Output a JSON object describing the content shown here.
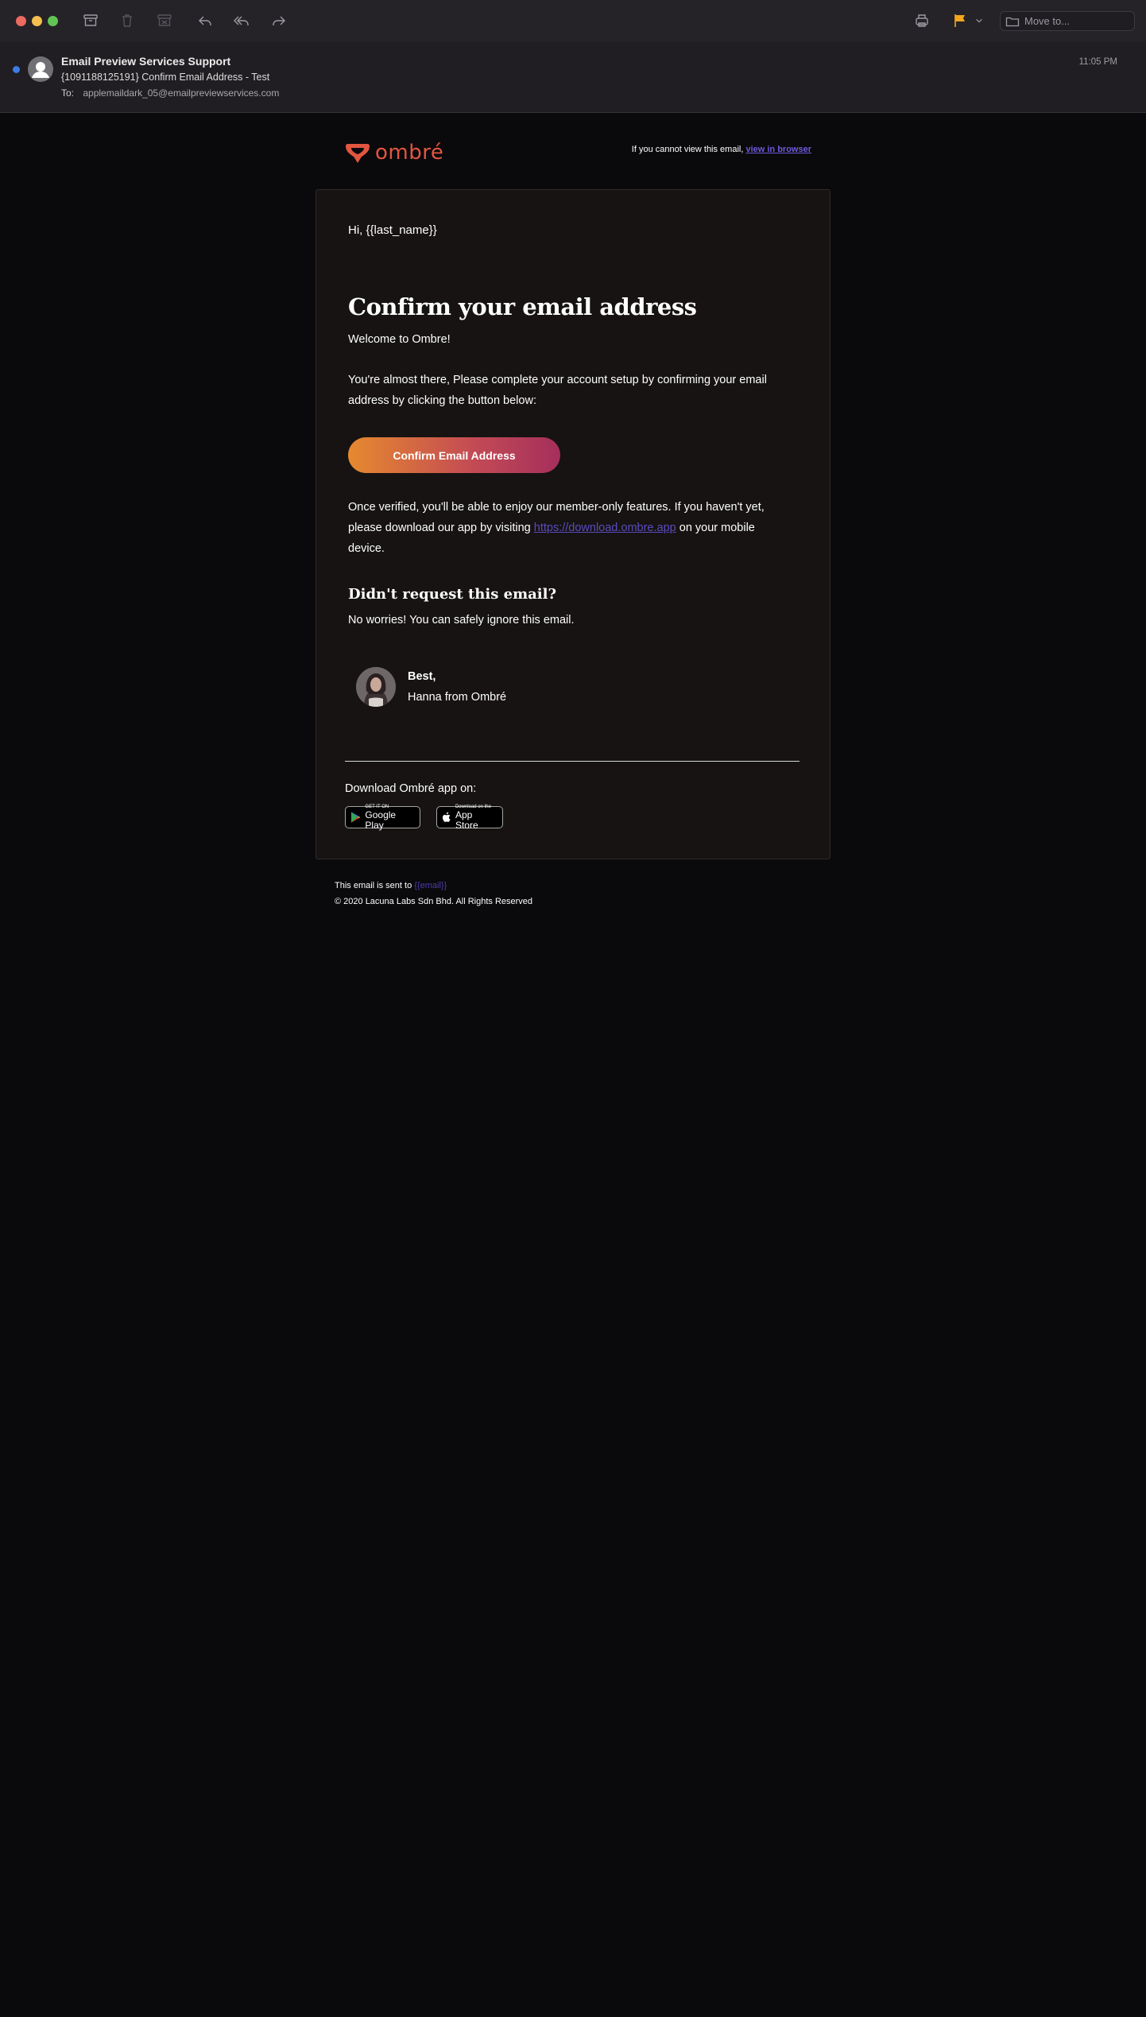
{
  "toolbar": {
    "move_to_placeholder": "Move to...",
    "flag_color": "#f2a51f"
  },
  "message": {
    "sender": "Email Preview Services Support",
    "subject": "{1091188125191} Confirm Email Address - Test",
    "to_label": "To:",
    "to_address": "applemaildark_05@emailpreviewservices.com",
    "time": "11:05 PM"
  },
  "email": {
    "logo_text": "ombré",
    "view_prefix": "If you cannot view this email,",
    "view_link": "view in browser",
    "greeting": "Hi, {{last_name}}",
    "headline": "Confirm your email address",
    "welcome": "Welcome to Ombre!",
    "para1": "You're almost there, Please complete your account setup by confirming your email address by clicking the button below:",
    "cta_label": "Confirm Email Address",
    "para2_prefix": "Once verified, you'll be able to enjoy our member-only features. If you haven't yet, please download our app by visiting",
    "para2_link": "https://download.ombre.app",
    "para2_suffix": "on your mobile device.",
    "didnt_request": "Didn't request this email?",
    "no_worries": "No worries! You can safely ignore this email.",
    "sig_best": "Best,",
    "sig_name": "Hanna from Ombré",
    "download_label": "Download Ombré app on:",
    "google_play_small": "GET IT ON",
    "google_play_big": "Google Play",
    "app_store_small": "Download on the",
    "app_store_big": "App Store",
    "footer_sent_prefix": "This email is sent to",
    "footer_sent_email": "{{email}}",
    "footer_copyright": "© 2020 Lacuna Labs Sdn Bhd. All Rights Reserved"
  },
  "colors": {
    "accent_logo": "#e2563f",
    "cta_gradient_start": "#e6892f",
    "cta_gradient_end": "#a52f5c",
    "link": "#6e5bd8"
  }
}
